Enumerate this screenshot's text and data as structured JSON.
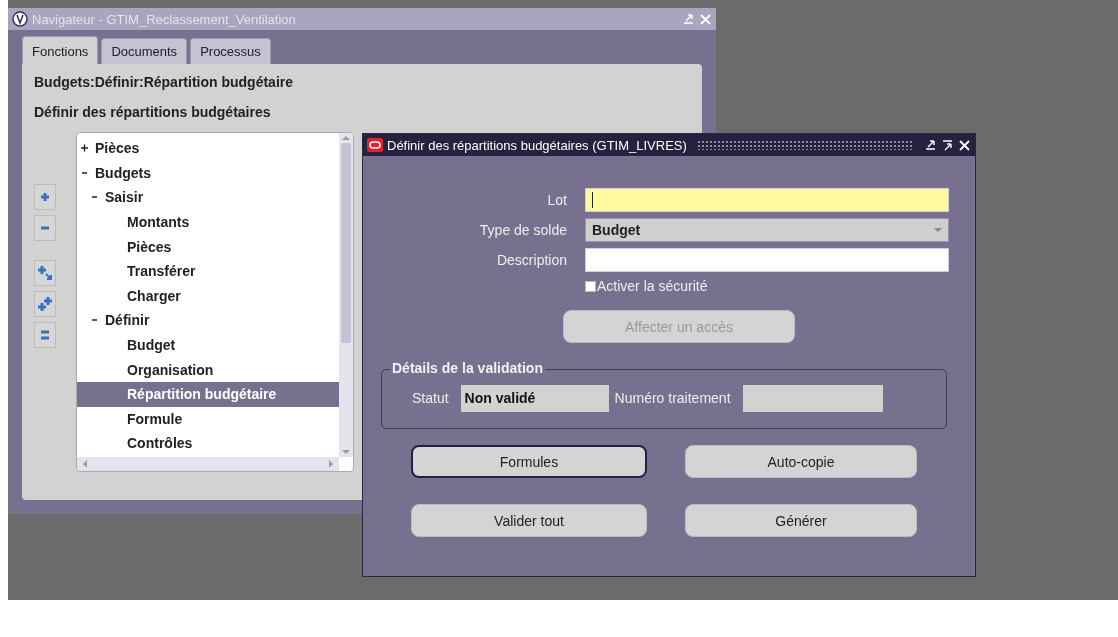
{
  "navigator": {
    "title": "Navigateur - GTIM_Reclassement_Ventilation",
    "active": false,
    "tabs": [
      {
        "label": "Fonctions",
        "selected": true
      },
      {
        "label": "Documents",
        "selected": false
      },
      {
        "label": "Processus",
        "selected": false
      }
    ],
    "path": "Budgets:Définir:Répartition budgétaire",
    "heading": "Définir des répartitions budgétaires",
    "tree": [
      {
        "label": "Pièces",
        "expanded": false,
        "selected": false
      },
      {
        "label": "Budgets",
        "expanded": true,
        "selected": false,
        "children": [
          {
            "label": "Saisir",
            "expanded": true,
            "selected": false,
            "children": [
              {
                "label": "Montants",
                "selected": false
              },
              {
                "label": "Pièces",
                "selected": false
              },
              {
                "label": "Transférer",
                "selected": false
              },
              {
                "label": "Charger",
                "selected": false
              }
            ]
          },
          {
            "label": "Définir",
            "expanded": true,
            "selected": false,
            "children": [
              {
                "label": "Budget",
                "selected": false
              },
              {
                "label": "Organisation",
                "selected": false
              },
              {
                "label": "Répartition budgétaire",
                "selected": true
              },
              {
                "label": "Formule",
                "selected": false
              },
              {
                "label": "Contrôles",
                "selected": false
              }
            ]
          }
        ]
      }
    ]
  },
  "dialog": {
    "title": "Définir des répartitions budgétaires (GTIM_LIVRES)",
    "active": true,
    "fields": [
      {
        "kind": "text",
        "label": "Lot",
        "required": true
      },
      {
        "kind": "dropdown",
        "label": "Type de solde",
        "value": "Budget"
      },
      {
        "kind": "text",
        "label": "Description",
        "required": false
      }
    ],
    "checkbox": {
      "label": "Activer la sécurité",
      "checked": false
    },
    "access_button": {
      "label": "Affecter un accès",
      "disabled": true
    },
    "validation": {
      "legend": "Détails de la validation",
      "status_label": "Statut",
      "status_value": "Non validé",
      "batch_label": "Numéro traitement"
    },
    "buttons": [
      {
        "label": "Formules",
        "focused": true,
        "disabled": false
      },
      {
        "label": "Auto-copie",
        "focused": false,
        "disabled": false
      },
      {
        "label": "Valider tout",
        "focused": false,
        "disabled": false
      },
      {
        "label": "Générer",
        "focused": false,
        "disabled": false
      }
    ]
  }
}
